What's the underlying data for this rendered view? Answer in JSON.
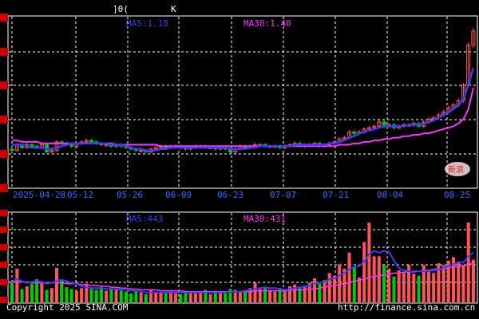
{
  "header": {
    "title": "]0(",
    "title_suffix": "K"
  },
  "price_panel": {
    "ma_short_label": "MA5:1.18",
    "ma_long_label": "MA30:1.40",
    "ma_short_color": "#3b3bff",
    "ma_long_color": "#ff33ff"
  },
  "volume_panel": {
    "ma_short_label": "MA5:443",
    "ma_long_label": "MA30:431",
    "ma_short_color": "#3b3bff",
    "ma_long_color": "#ff33ff"
  },
  "x_axis_labels": [
    "2025-04-28",
    "05-12",
    "05-26",
    "06-09",
    "06-23",
    "07-07",
    "07-21",
    "08-04",
    "08-25"
  ],
  "footer": {
    "copyright": "Copyright 2025 SINA.COM",
    "url": "http://finance.sina.com.cn"
  },
  "watermark": "新浪",
  "colors": {
    "up": "#ff5555",
    "down": "#00cc00",
    "grid": "#ffffff",
    "axis_marker": "#cc0000"
  },
  "chart_data": [
    {
      "type": "candlestick",
      "title": "",
      "categories": [
        "2025-04-28",
        "05-12",
        "05-26",
        "06-09",
        "06-23",
        "07-07",
        "07-21",
        "08-04",
        "08-25"
      ],
      "close": [
        0.96,
        1.0,
        0.98,
        1.0,
        0.99,
        0.98,
        1.0,
        0.95,
        0.96,
        1.02,
        1.01,
        1.0,
        0.99,
        1.01,
        1.02,
        1.03,
        1.02,
        1.01,
        1.0,
        1.0,
        0.99,
        1.0,
        0.99,
        0.98,
        0.97,
        0.96,
        0.96,
        0.95,
        0.97,
        0.98,
        0.99,
        0.98,
        0.99,
        0.99,
        0.98,
        0.97,
        0.98,
        0.99,
        0.99,
        0.98,
        0.98,
        0.97,
        0.98,
        0.97,
        0.95,
        0.97,
        0.99,
        0.98,
        0.99,
        1.0,
        1.0,
        0.99,
        0.99,
        0.99,
        0.98,
        0.99,
        1.0,
        1.01,
        0.99,
        1.0,
        1.0,
        1.01,
        0.99,
        1.0,
        1.01,
        1.02,
        1.04,
        1.05,
        1.09,
        1.08,
        1.09,
        1.11,
        1.12,
        1.13,
        1.16,
        1.13,
        1.14,
        1.12,
        1.13,
        1.14,
        1.14,
        1.15,
        1.13,
        1.16,
        1.18,
        1.19,
        1.21,
        1.23,
        1.26,
        1.28,
        1.31,
        1.42,
        1.7,
        1.8
      ],
      "ma_short": [
        1.0,
        1.0,
        1.0,
        0.99,
        0.98,
        0.98,
        0.98,
        0.97,
        0.97,
        0.98,
        0.99,
        1.0,
        1.01,
        1.01,
        1.01,
        1.01,
        1.01,
        1.01,
        1.01,
        1.01,
        1.0,
        1.0,
        1.0,
        0.99,
        0.98,
        0.97,
        0.97,
        0.96,
        0.96,
        0.96,
        0.97,
        0.97,
        0.98,
        0.98,
        0.98,
        0.98,
        0.98,
        0.98,
        0.98,
        0.98,
        0.98,
        0.98,
        0.98,
        0.98,
        0.97,
        0.97,
        0.97,
        0.97,
        0.98,
        0.98,
        0.99,
        0.99,
        0.99,
        0.99,
        0.99,
        0.99,
        0.99,
        1.0,
        1.0,
        1.0,
        1.0,
        1.0,
        1.0,
        1.0,
        1.01,
        1.01,
        1.02,
        1.03,
        1.05,
        1.06,
        1.08,
        1.09,
        1.1,
        1.11,
        1.12,
        1.13,
        1.13,
        1.13,
        1.13,
        1.13,
        1.14,
        1.14,
        1.14,
        1.15,
        1.16,
        1.17,
        1.19,
        1.21,
        1.23,
        1.25,
        1.28,
        1.32,
        1.42,
        1.54
      ],
      "ma_long": [
        1.03,
        1.03,
        1.02,
        1.02,
        1.02,
        1.02,
        1.01,
        1.01,
        1.01,
        1.01,
        1.01,
        1.01,
        1.01,
        1.01,
        1.01,
        1.01,
        1.01,
        1.01,
        1.01,
        1.01,
        1.01,
        1.0,
        1.0,
        1.0,
        1.0,
        1.0,
        1.0,
        1.0,
        1.0,
        1.0,
        0.99,
        0.99,
        0.99,
        0.99,
        0.99,
        0.99,
        0.99,
        0.99,
        0.99,
        0.99,
        0.99,
        0.99,
        0.99,
        0.99,
        0.99,
        0.99,
        0.99,
        0.99,
        0.99,
        0.99,
        0.99,
        0.99,
        0.99,
        0.99,
        0.99,
        0.99,
        0.99,
        0.99,
        0.99,
        0.99,
        0.99,
        0.99,
        0.99,
        0.99,
        0.99,
        0.99,
        1.0,
        1.0,
        1.0,
        1.01,
        1.01,
        1.02,
        1.02,
        1.03,
        1.03,
        1.04,
        1.04,
        1.05,
        1.05,
        1.06,
        1.06,
        1.07,
        1.07,
        1.08,
        1.08,
        1.09,
        1.1,
        1.11,
        1.12,
        1.13,
        1.15,
        1.18,
        1.25,
        1.4
      ],
      "ylim": [
        0.7,
        1.9
      ]
    },
    {
      "type": "bar",
      "title": "",
      "volume": [
        220,
        380,
        150,
        180,
        210,
        260,
        230,
        140,
        160,
        390,
        260,
        170,
        150,
        130,
        160,
        210,
        150,
        140,
        170,
        130,
        160,
        140,
        130,
        120,
        100,
        130,
        110,
        90,
        140,
        120,
        110,
        100,
        120,
        100,
        90,
        130,
        110,
        100,
        120,
        140,
        90,
        130,
        110,
        100,
        150,
        140,
        120,
        130,
        160,
        220,
        150,
        160,
        140,
        120,
        160,
        130,
        180,
        200,
        160,
        190,
        220,
        270,
        210,
        250,
        330,
        300,
        430,
        380,
        560,
        400,
        280,
        680,
        900,
        520,
        520,
        420,
        380,
        290,
        360,
        330,
        420,
        320,
        300,
        420,
        350,
        330,
        440,
        420,
        470,
        510,
        460,
        420,
        900,
        480
      ],
      "ma_short": [
        240,
        260,
        240,
        220,
        230,
        240,
        230,
        210,
        220,
        240,
        250,
        240,
        220,
        210,
        180,
        170,
        160,
        160,
        160,
        150,
        150,
        150,
        140,
        140,
        130,
        130,
        120,
        110,
        110,
        110,
        110,
        110,
        110,
        110,
        110,
        110,
        110,
        110,
        110,
        110,
        110,
        110,
        110,
        110,
        120,
        120,
        120,
        130,
        140,
        150,
        160,
        170,
        160,
        160,
        150,
        140,
        150,
        160,
        170,
        180,
        190,
        210,
        220,
        230,
        260,
        270,
        300,
        330,
        370,
        400,
        410,
        460,
        540,
        580,
        560,
        580,
        570,
        470,
        390,
        360,
        350,
        340,
        350,
        350,
        350,
        360,
        370,
        390,
        410,
        430,
        450,
        450,
        520,
        560
      ],
      "ma_long": [
        230,
        230,
        230,
        230,
        220,
        220,
        220,
        220,
        220,
        220,
        220,
        210,
        210,
        210,
        200,
        200,
        190,
        190,
        180,
        180,
        170,
        170,
        160,
        160,
        150,
        150,
        140,
        140,
        140,
        140,
        130,
        130,
        130,
        130,
        130,
        120,
        120,
        120,
        120,
        120,
        120,
        120,
        120,
        120,
        120,
        120,
        120,
        120,
        120,
        130,
        130,
        130,
        130,
        130,
        130,
        130,
        140,
        140,
        140,
        140,
        150,
        150,
        160,
        170,
        180,
        190,
        200,
        210,
        220,
        240,
        250,
        260,
        280,
        290,
        300,
        310,
        320,
        330,
        330,
        340,
        340,
        350,
        350,
        360,
        360,
        370,
        380,
        380,
        390,
        400,
        400,
        410,
        430,
        440
      ],
      "ylim": [
        0,
        1000
      ]
    }
  ]
}
